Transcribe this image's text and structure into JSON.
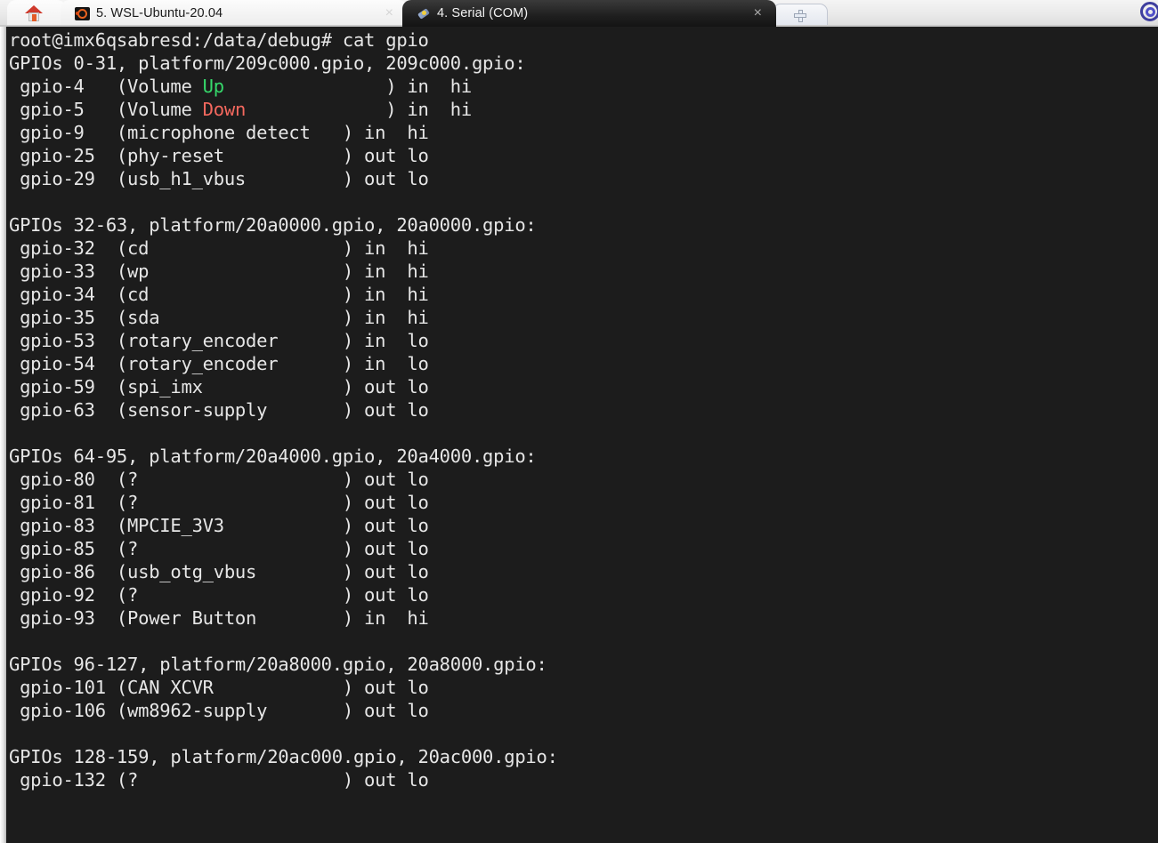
{
  "window": {
    "app": "terminal-emulator",
    "corner_icon": "app-logo-icon"
  },
  "tabbar": {
    "home_tab": {
      "icon": "home-icon",
      "label": ""
    },
    "tabs": [
      {
        "label": "5. WSL-Ubuntu-20.04",
        "icon": "ubuntu-icon",
        "active": false,
        "close_label": "×"
      },
      {
        "label": "4. Serial (COM)",
        "icon": "serial-port-icon",
        "active": true,
        "close_label": "×"
      }
    ],
    "new_tab": {
      "icon": "plus-icon",
      "label": ""
    }
  },
  "terminal": {
    "prompt": "root@imx6qsabresd:/data/debug# cat gpio",
    "colors": {
      "background": "#1c1c1c",
      "foreground": "#e6e6e6",
      "green": "#36d96b",
      "red": "#f4685e"
    },
    "lines": [
      {
        "type": "prompt",
        "text": "root@imx6qsabresd:/data/debug# cat gpio"
      },
      {
        "type": "plain",
        "text": "GPIOs 0-31, platform/209c000.gpio, 209c000.gpio:"
      },
      {
        "type": "rich",
        "parts": [
          {
            "text": " gpio-4   (Volume "
          },
          {
            "text": "Up",
            "color": "green"
          },
          {
            "text": "               ) in  hi"
          }
        ]
      },
      {
        "type": "rich",
        "parts": [
          {
            "text": " gpio-5   (Volume "
          },
          {
            "text": "Down",
            "color": "red"
          },
          {
            "text": "             ) in  hi"
          }
        ]
      },
      {
        "type": "plain",
        "text": " gpio-9   (microphone detect   ) in  hi"
      },
      {
        "type": "plain",
        "text": " gpio-25  (phy-reset           ) out lo"
      },
      {
        "type": "plain",
        "text": " gpio-29  (usb_h1_vbus         ) out lo"
      },
      {
        "type": "plain",
        "text": ""
      },
      {
        "type": "plain",
        "text": "GPIOs 32-63, platform/20a0000.gpio, 20a0000.gpio:"
      },
      {
        "type": "plain",
        "text": " gpio-32  (cd                  ) in  hi"
      },
      {
        "type": "plain",
        "text": " gpio-33  (wp                  ) in  hi"
      },
      {
        "type": "plain",
        "text": " gpio-34  (cd                  ) in  hi"
      },
      {
        "type": "plain",
        "text": " gpio-35  (sda                 ) in  hi"
      },
      {
        "type": "plain",
        "text": " gpio-53  (rotary_encoder      ) in  lo"
      },
      {
        "type": "plain",
        "text": " gpio-54  (rotary_encoder      ) in  lo"
      },
      {
        "type": "plain",
        "text": " gpio-59  (spi_imx             ) out lo"
      },
      {
        "type": "plain",
        "text": " gpio-63  (sensor-supply       ) out lo"
      },
      {
        "type": "plain",
        "text": ""
      },
      {
        "type": "plain",
        "text": "GPIOs 64-95, platform/20a4000.gpio, 20a4000.gpio:"
      },
      {
        "type": "plain",
        "text": " gpio-80  (?                   ) out lo"
      },
      {
        "type": "plain",
        "text": " gpio-81  (?                   ) out lo"
      },
      {
        "type": "plain",
        "text": " gpio-83  (MPCIE_3V3           ) out lo"
      },
      {
        "type": "plain",
        "text": " gpio-85  (?                   ) out lo"
      },
      {
        "type": "plain",
        "text": " gpio-86  (usb_otg_vbus        ) out lo"
      },
      {
        "type": "plain",
        "text": " gpio-92  (?                   ) out lo"
      },
      {
        "type": "plain",
        "text": " gpio-93  (Power Button        ) in  hi"
      },
      {
        "type": "plain",
        "text": ""
      },
      {
        "type": "plain",
        "text": "GPIOs 96-127, platform/20a8000.gpio, 20a8000.gpio:"
      },
      {
        "type": "plain",
        "text": " gpio-101 (CAN XCVR            ) out lo"
      },
      {
        "type": "plain",
        "text": " gpio-106 (wm8962-supply       ) out lo"
      },
      {
        "type": "plain",
        "text": ""
      },
      {
        "type": "plain",
        "text": "GPIOs 128-159, platform/20ac000.gpio, 20ac000.gpio:"
      },
      {
        "type": "plain",
        "text": " gpio-132 (?                   ) out lo"
      }
    ]
  }
}
